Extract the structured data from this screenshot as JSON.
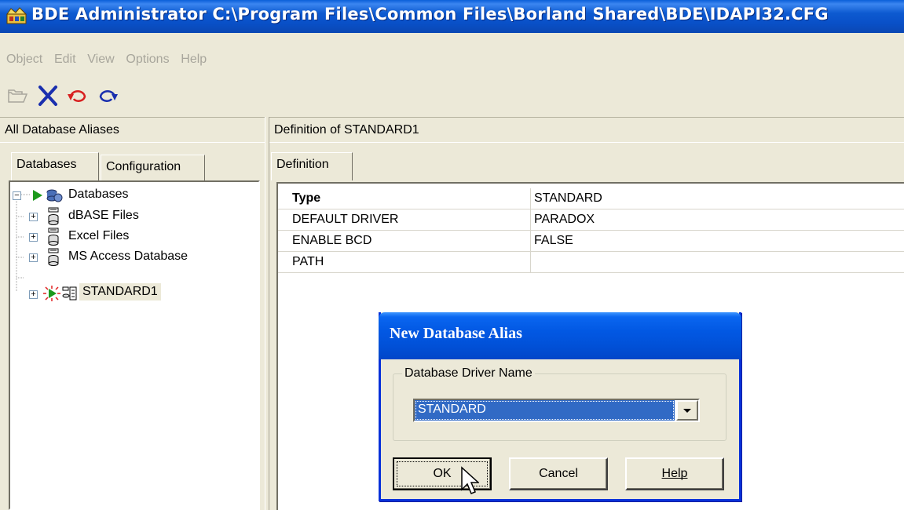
{
  "window": {
    "title": "BDE Administrator  C:\\Program Files\\Common Files\\Borland Shared\\BDE\\IDAPI32.CFG"
  },
  "menu": [
    "Object",
    "Edit",
    "View",
    "Options",
    "Help"
  ],
  "toolbar": {
    "buttons": [
      "open-icon",
      "delete-icon",
      "undo-icon",
      "redo-icon"
    ]
  },
  "left_panel": {
    "header": "All Database Aliases",
    "tabs": [
      "Databases",
      "Configuration"
    ],
    "tree": {
      "root": "Databases",
      "items": [
        "dBASE Files",
        "Excel Files",
        "MS Access Database",
        "STANDARD1"
      ]
    }
  },
  "right_panel": {
    "header": "Definition of STANDARD1",
    "tab": "Definition",
    "rows": [
      {
        "key": "Type",
        "value": "STANDARD"
      },
      {
        "key": "DEFAULT DRIVER",
        "value": "PARADOX"
      },
      {
        "key": "ENABLE BCD",
        "value": "FALSE"
      },
      {
        "key": "PATH",
        "value": ""
      }
    ]
  },
  "dialog": {
    "title": "New Database Alias",
    "group_label": "Database Driver Name",
    "driver_selected": "STANDARD",
    "ok_label": "OK",
    "cancel_label": "Cancel",
    "help_label": "Help"
  },
  "colors": {
    "title_bar": "#0a55d4",
    "selection": "#316ac5",
    "face": "#ece9d8"
  }
}
